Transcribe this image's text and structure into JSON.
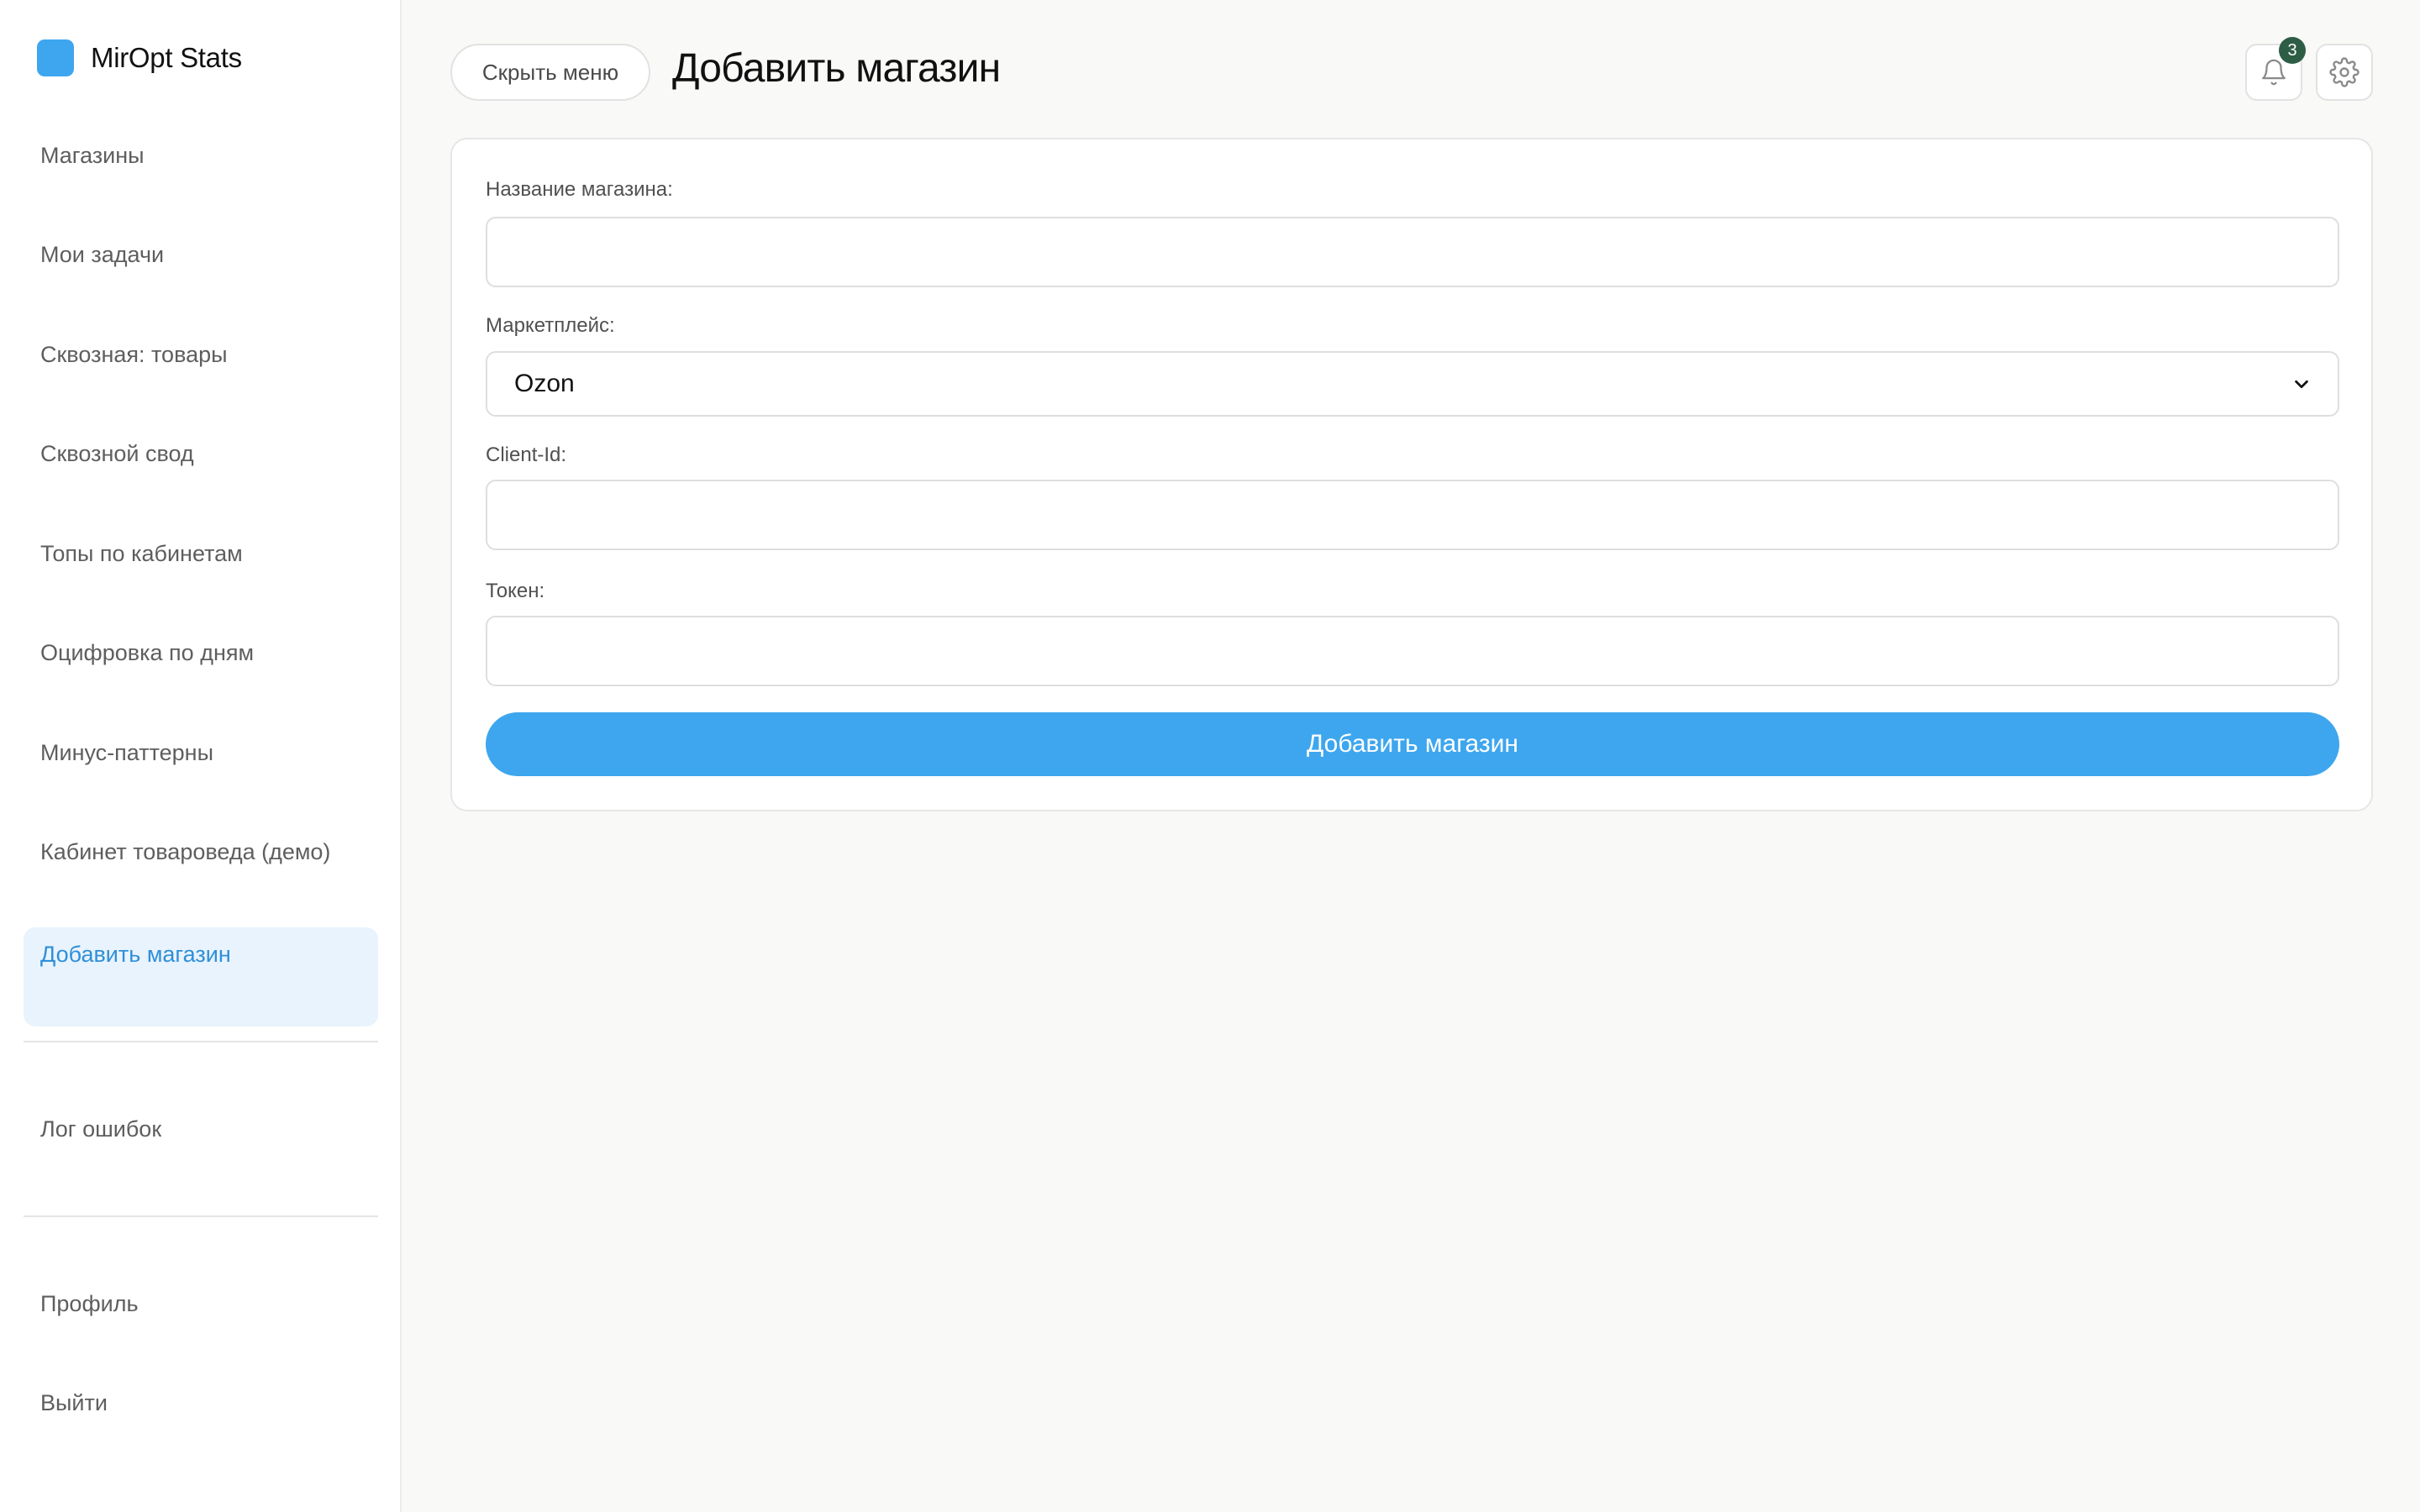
{
  "brand": {
    "name": "MirOpt Stats",
    "logo_color": "#3ea6ee"
  },
  "sidebar": {
    "items": [
      {
        "label": "Магазины"
      },
      {
        "label": "Мои задачи"
      },
      {
        "label": "Сквозная: товары"
      },
      {
        "label": "Сквозной свод"
      },
      {
        "label": "Топы по кабинетам"
      },
      {
        "label": "Оцифровка по дням"
      },
      {
        "label": "Минус-паттерны"
      },
      {
        "label": "Кабинет товароведа (демо)"
      },
      {
        "label": "Добавить магазин",
        "active": true
      }
    ],
    "secondary": [
      {
        "label": "Лог ошибок"
      }
    ],
    "footer": [
      {
        "label": "Профиль"
      },
      {
        "label": "Выйти"
      }
    ]
  },
  "header": {
    "hide_menu_label": "Скрыть меню",
    "title": "Добавить магазин",
    "notifications_count": "3",
    "icons": {
      "notifications": "bell-icon",
      "settings": "gear-icon"
    }
  },
  "form": {
    "store_name": {
      "label": "Название магазина:",
      "value": ""
    },
    "marketplace": {
      "label": "Маркетплейс:",
      "value": "Ozon"
    },
    "client_id": {
      "label": "Client-Id:",
      "value": ""
    },
    "token": {
      "label": "Токен:",
      "value": ""
    },
    "submit_label": "Добавить магазин"
  },
  "colors": {
    "accent": "#3ea6ee",
    "active_bg": "#e8f3fd",
    "active_text": "#2f8fd8",
    "badge": "#2e5d46"
  }
}
